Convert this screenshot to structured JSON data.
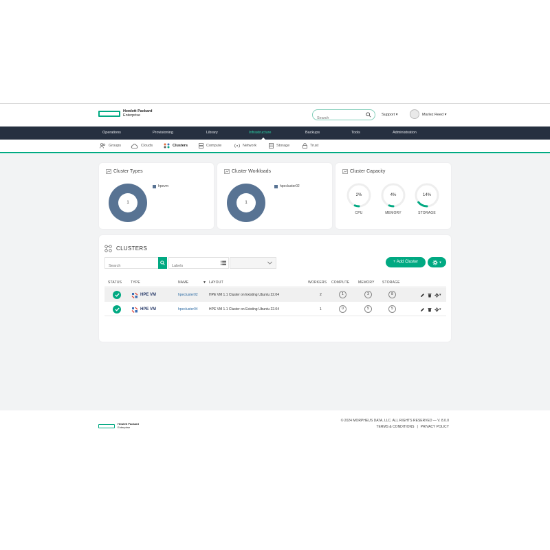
{
  "header": {
    "logo_line1": "Hewlett Packard",
    "logo_line2": "Enterprise",
    "search_placeholder": "Search",
    "support_label": "Support",
    "user_name": "Marlez Reed"
  },
  "main_nav": {
    "items": [
      {
        "label": "Operations"
      },
      {
        "label": "Provisioning"
      },
      {
        "label": "Library"
      },
      {
        "label": "Infrastructure"
      },
      {
        "label": "Backups"
      },
      {
        "label": "Tools"
      },
      {
        "label": "Administration"
      }
    ],
    "active": "Infrastructure"
  },
  "sub_nav": {
    "items": [
      {
        "label": "Groups",
        "icon": "groups-icon"
      },
      {
        "label": "Clouds",
        "icon": "clouds-icon"
      },
      {
        "label": "Clusters",
        "icon": "clusters-icon"
      },
      {
        "label": "Compute",
        "icon": "compute-icon"
      },
      {
        "label": "Network",
        "icon": "network-icon"
      },
      {
        "label": "Storage",
        "icon": "storage-icon"
      },
      {
        "label": "Trust",
        "icon": "trust-icon"
      }
    ],
    "active": "Clusters"
  },
  "cards": {
    "types": {
      "title": "Cluster Types",
      "value": "1",
      "legend": "hpevm",
      "color": "#587393"
    },
    "workloads": {
      "title": "Cluster Workloads",
      "value": "1",
      "legend": "hpecluster02",
      "color": "#587393"
    },
    "capacity": {
      "title": "Cluster Capacity",
      "gauges": [
        {
          "label": "CPU",
          "value": "2%",
          "fraction": 0.02
        },
        {
          "label": "MEMORY",
          "value": "4%",
          "fraction": 0.04
        },
        {
          "label": "STORAGE",
          "value": "14%",
          "fraction": 0.14
        }
      ]
    }
  },
  "clusters": {
    "title": "CLUSTERS",
    "search_placeholder": "Search",
    "labels_placeholder": "Labels",
    "add_button": "+ Add Cluster",
    "columns": {
      "status": "STATUS",
      "type": "TYPE",
      "name": "NAME",
      "layout": "LAYOUT",
      "workers": "WORKERS",
      "compute": "COMPUTE",
      "memory": "MEMORY",
      "storage": "STORAGE"
    },
    "rows": [
      {
        "type": "HPE VM",
        "name": "hpecluster02",
        "layout": "HPE VM 1.1 Cluster on Existing Ubuntu 22.04",
        "workers": "2",
        "compute": "1",
        "memory": "3",
        "storage": "8"
      },
      {
        "type": "HPE VM",
        "name": "hpecluster04",
        "layout": "HPE VM 1.1 Cluster on Existing Ubuntu 22.04",
        "workers": "1",
        "compute": "0",
        "memory": "5",
        "storage": "5"
      }
    ]
  },
  "footer": {
    "logo_line1": "Hewlett Packard",
    "logo_line2": "Enterprise",
    "copyright": "© 2024 MORPHEUS DATA, LLC. ALL RIGHTS RESERVED — V. 8.0.0",
    "terms": "TERMS & CONDITIONS",
    "separator": "|",
    "privacy": "PRIVACY POLICY"
  },
  "colors": {
    "accent": "#01a982",
    "nav_bg": "#263040",
    "nav_active": "#2ad2a6",
    "donut": "#587393",
    "link": "#2b6aa3"
  }
}
